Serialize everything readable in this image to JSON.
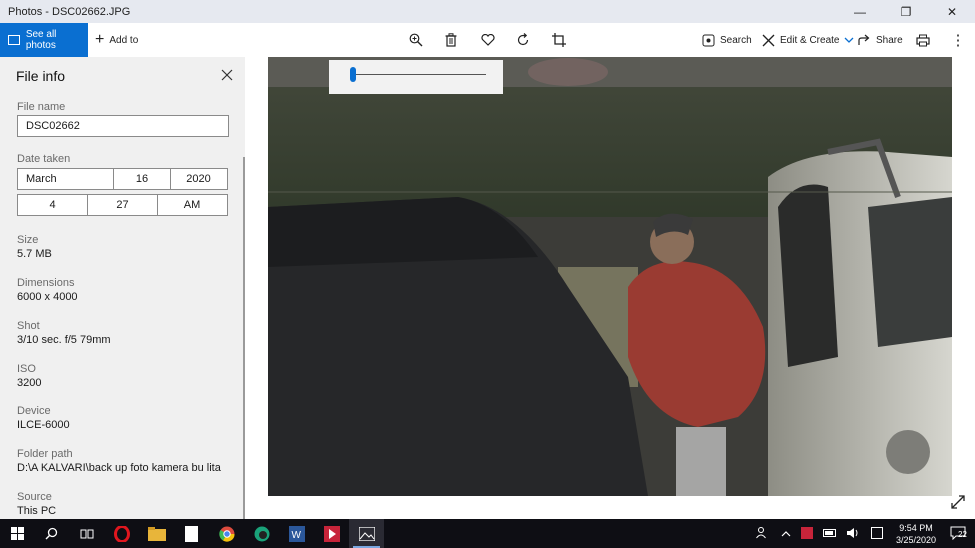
{
  "window": {
    "title": "Photos - DSC02662.JPG",
    "minimize_glyph": "—",
    "maximize_glyph": "❐",
    "close_glyph": "✕"
  },
  "toolbar": {
    "see_all_label": "See all photos",
    "add_to_label": "Add to",
    "search_label": "Search",
    "edit_create_label": "Edit & Create",
    "share_label": "Share",
    "more_glyph": "⋮",
    "icons": [
      "zoom-icon",
      "delete-icon",
      "favorite-icon",
      "rotate-icon",
      "crop-icon",
      "search-icon",
      "edit-icon",
      "share-icon",
      "print-icon",
      "more-icon"
    ]
  },
  "file_info": {
    "heading": "File info",
    "file_name_label": "File name",
    "file_name_value": "DSC02662",
    "date_taken_label": "Date taken",
    "date": {
      "month": "March",
      "day": "16",
      "year": "2020"
    },
    "time": {
      "hour": "4",
      "minute": "27",
      "ampm": "AM"
    },
    "size_label": "Size",
    "size_value": "5.7 MB",
    "dimensions_label": "Dimensions",
    "dimensions_value": "6000 x 4000",
    "shot_label": "Shot",
    "shot_value": "3/10 sec. f/5 79mm",
    "iso_label": "ISO",
    "iso_value": "3200",
    "device_label": "Device",
    "device_value": "ILCE-6000",
    "folder_label": "Folder path",
    "folder_value": "D:\\A KALVARI\\back up foto kamera bu lita",
    "source_label": "Source",
    "source_value": "This PC"
  },
  "zoom": {
    "level": 0.02
  },
  "taskbar": {
    "apps": [
      "start-icon",
      "search-icon",
      "task-view-icon",
      "opera-icon",
      "file-explorer-icon",
      "notepad-icon",
      "chrome-icon",
      "camtasia-icon",
      "word-icon",
      "video-player-icon",
      "photos-icon"
    ],
    "time": "9:54 PM",
    "date": "3/25/2020",
    "notification_count": "22"
  },
  "colors": {
    "accent": "#0a6fd1",
    "taskbar": "#0e0e14",
    "pane": "#f0f0f0"
  }
}
